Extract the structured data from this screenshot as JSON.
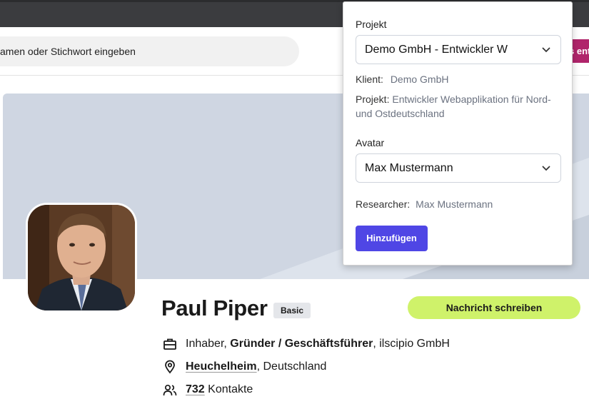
{
  "search": {
    "text": "amen oder Stichwort eingeben"
  },
  "side_button": {
    "label": "s ent"
  },
  "profile": {
    "name": "Paul Piper",
    "badge": "Basic",
    "message_button": "Nachricht schreiben",
    "job": {
      "prefix": "Inhaber, ",
      "role": "Gründer / Geschäftsführer",
      "company": ", ilscipio GmbH"
    },
    "location": {
      "city": "Heuchelheim",
      "country": ", Deutschland"
    },
    "contacts": {
      "count": "732",
      "label": " Kontakte"
    }
  },
  "popover": {
    "project_label": "Projekt",
    "project_select": "Demo GmbH - Entwickler W",
    "client_label": "Klient:",
    "client_value": "Demo GmbH",
    "project_info_label": "Projekt:",
    "project_info_value": "Entwickler Webapplikation für Nord- und Ostdeutschland",
    "avatar_label": "Avatar",
    "avatar_select": "Max Mustermann",
    "researcher_label": "Researcher:",
    "researcher_value": "Max Mustermann",
    "add_button": "Hinzufügen"
  },
  "colors": {
    "accent": "#4f46e5",
    "message": "#cff26a",
    "banner": "#cfd6e2",
    "side_button": "#b0256b"
  },
  "icons": [
    "briefcase-icon",
    "location-pin-icon",
    "contacts-icon",
    "chevron-down-icon"
  ]
}
